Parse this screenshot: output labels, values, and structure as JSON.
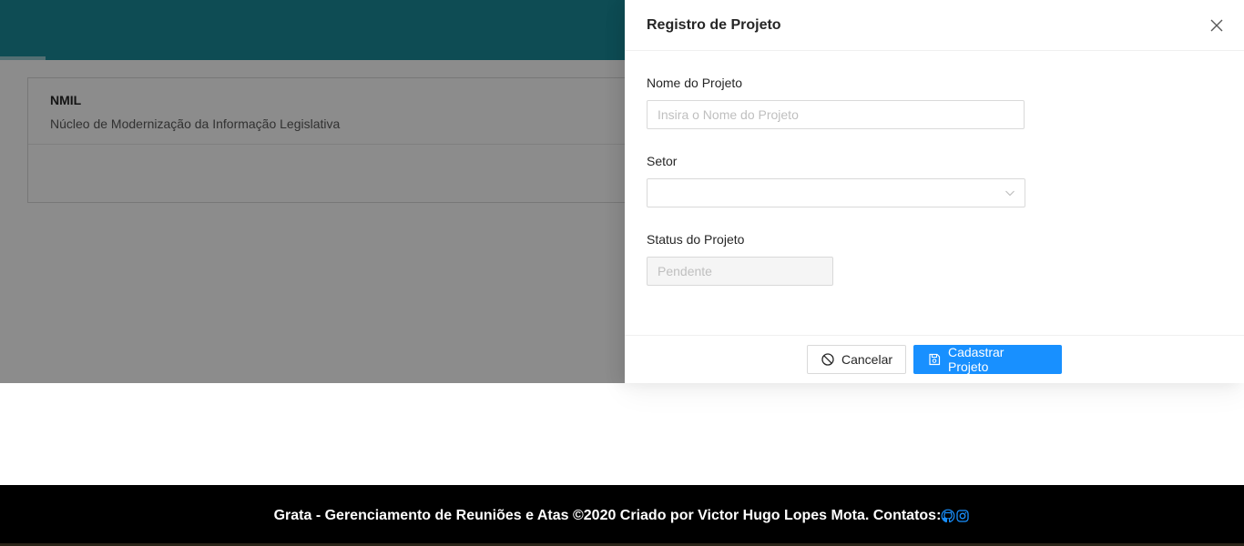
{
  "background": {
    "card": {
      "title": "NMIL",
      "subtitle": "Núcleo de Modernização da Informação Legislativa"
    }
  },
  "drawer": {
    "title": "Registro de Projeto",
    "fields": {
      "nome": {
        "label": "Nome do Projeto",
        "placeholder": "Insira o Nome do Projeto",
        "value": ""
      },
      "setor": {
        "label": "Setor",
        "value": ""
      },
      "status": {
        "label": "Status do Projeto",
        "value": "Pendente"
      }
    },
    "buttons": {
      "cancel": "Cancelar",
      "submit": "Cadastrar Projeto"
    }
  },
  "footer": {
    "text": "Grata - Gerenciamento de Reuniões e Atas ©2020 Criado por Victor Hugo Lopes Mota. Contatos:",
    "icons": [
      "github-icon",
      "instagram-icon"
    ]
  },
  "colors": {
    "header": "#1b8a9a",
    "primary": "#1890ff",
    "footer": "#000000"
  }
}
